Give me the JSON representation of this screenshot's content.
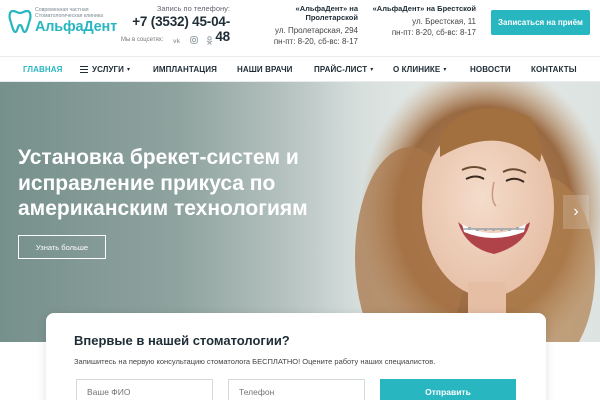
{
  "brand": {
    "tagline_1": "Современная частная",
    "tagline_2": "Стоматологическая клиника",
    "name": "АльфаДент",
    "accent_color": "#28b6c1"
  },
  "contact": {
    "phone_caption": "Запись по телефону:",
    "phone": "+7 (3532) 45-04-48",
    "social_caption": "Мы в соцсетях:",
    "social_icons": [
      "vk-icon",
      "instagram-icon",
      "odnoklassniki-icon"
    ]
  },
  "addresses": [
    {
      "title": "«АльфаДент» на Пролетарской",
      "street": "ул. Пролетарская, 294",
      "hours": "пн-пт: 8-20, сб-вс: 8-17"
    },
    {
      "title": "«АльфаДент» на Брестской",
      "street": "ул. Брестская, 11",
      "hours": "пн-пт: 8-20, сб-вс: 8-17"
    }
  ],
  "header_cta": "Записаться на приём",
  "nav": {
    "items": [
      {
        "label": "ГЛАВНАЯ"
      },
      {
        "label": "УСЛУГИ"
      },
      {
        "label": "ИМПЛАНТАЦИЯ"
      },
      {
        "label": "НАШИ ВРАЧИ"
      },
      {
        "label": "ПРАЙС-ЛИСТ"
      },
      {
        "label": "О КЛИНИКЕ"
      },
      {
        "label": "НОВОСТИ"
      },
      {
        "label": "КОНТАКТЫ"
      }
    ],
    "active_index": 0
  },
  "hero": {
    "title": "Установка брекет-систем и исправление прикуса по американским технологиям",
    "button": "Узнать больше",
    "next_icon": "chevron-right-icon"
  },
  "form": {
    "title": "Впервые в нашей стоматологии?",
    "subtitle": "Запишитесь на первую консультацию стоматолога БЕСПЛАТНО! Оцените работу наших специалистов.",
    "name_placeholder": "Ваше ФИО",
    "phone_placeholder": "Телефон",
    "submit": "Отправить"
  }
}
